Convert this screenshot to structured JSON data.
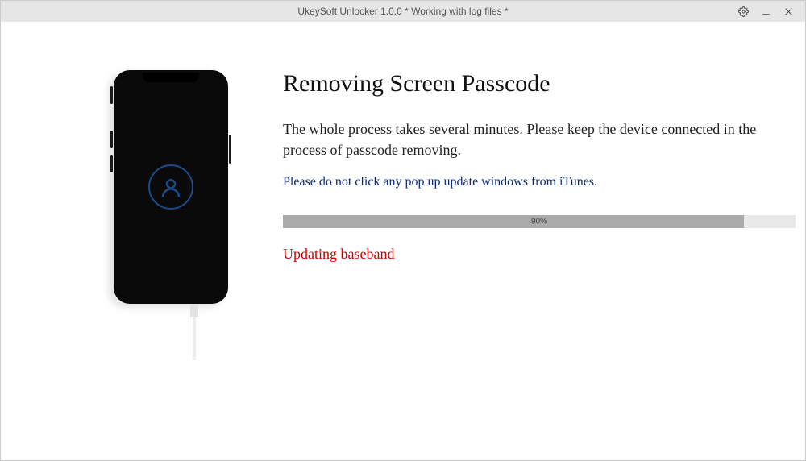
{
  "titlebar": {
    "title": "UkeySoft Unlocker 1.0.0 * Working with log files *"
  },
  "main": {
    "heading": "Removing Screen Passcode",
    "description": "The whole process takes several minutes. Please keep the device connected in the process of passcode removing.",
    "warning": "Please do not click any pop up update windows from iTunes.",
    "progress": {
      "percent": 90,
      "label": "90%"
    },
    "status": "Updating baseband"
  }
}
